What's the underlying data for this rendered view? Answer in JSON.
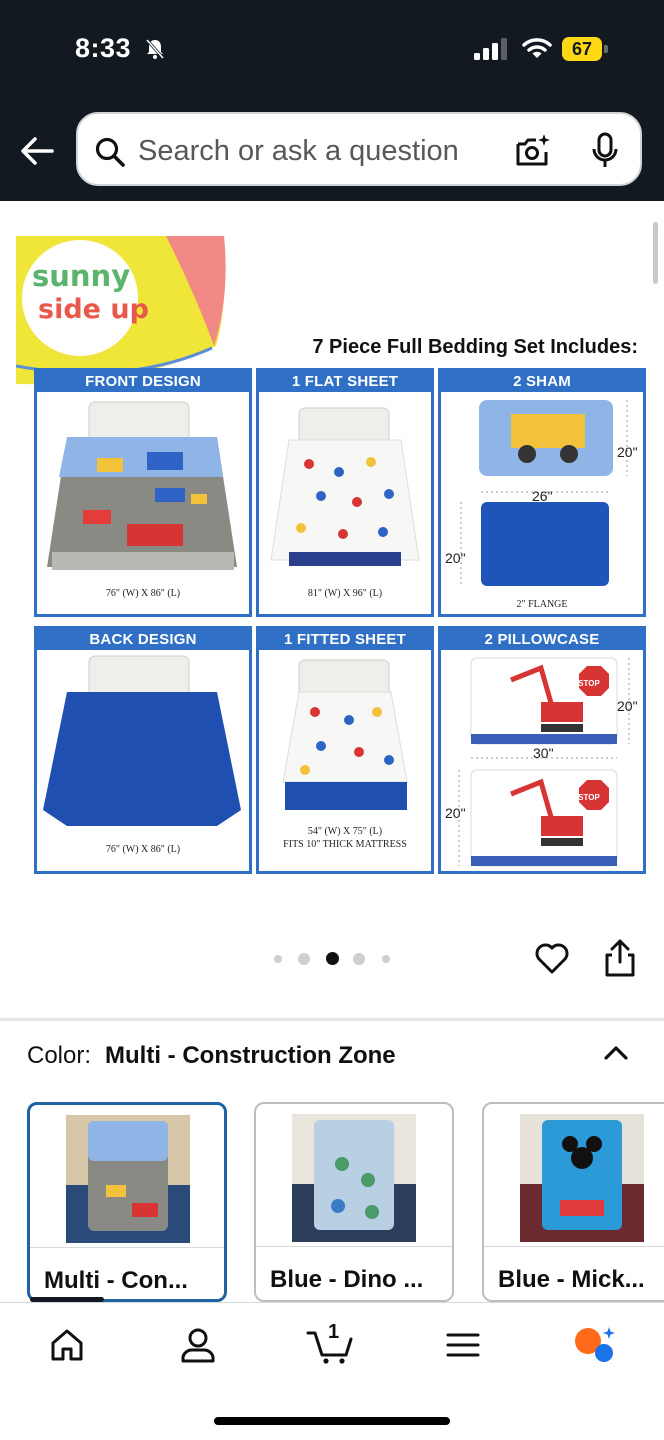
{
  "status_bar": {
    "time": "8:33",
    "battery": "67"
  },
  "header": {
    "search_placeholder": "Search or ask a question"
  },
  "product_image": {
    "logo_text_1": "sunny",
    "logo_text_2": "side up",
    "set_title": "7 Piece Full Bedding Set Includes:",
    "panels": [
      {
        "title": "FRONT DESIGN",
        "caption": "76\" (W) X 86\" (L)"
      },
      {
        "title": "1 FLAT SHEET",
        "caption": "81\" (W) X 96\" (L)"
      },
      {
        "title": "2 SHAM",
        "caption": "2\" FLANGE",
        "dim_h": "20\"",
        "dim_w": "26\"",
        "dim_h2": "20\""
      },
      {
        "title": "BACK DESIGN",
        "caption": "76\" (W) X 86\" (L)"
      },
      {
        "title": "1 FITTED SHEET",
        "caption": "54\" (W) X 75\" (L)",
        "caption2": "FITS 10\" THICK MATTRESS"
      },
      {
        "title": "2 PILLOWCASE",
        "dim_h": "20\"",
        "dim_w": "30\"",
        "dim_h2": "20\"",
        "stop_text": "STOP"
      }
    ]
  },
  "carousel": {
    "active_index": 2,
    "count": 5
  },
  "variation": {
    "label": "Color:",
    "value": "Multi - Construction Zone",
    "swatches": [
      {
        "label": "Multi - Con...",
        "selected": true
      },
      {
        "label": "Blue - Dino ...",
        "selected": false
      },
      {
        "label": "Blue - Mick...",
        "selected": false
      }
    ]
  },
  "bottom_nav": {
    "cart_count": "1"
  },
  "colors": {
    "header_bg": "#131921",
    "accent_blue": "#2f6fc6",
    "selected_border": "#2162a1",
    "battery": "#ffd814"
  }
}
